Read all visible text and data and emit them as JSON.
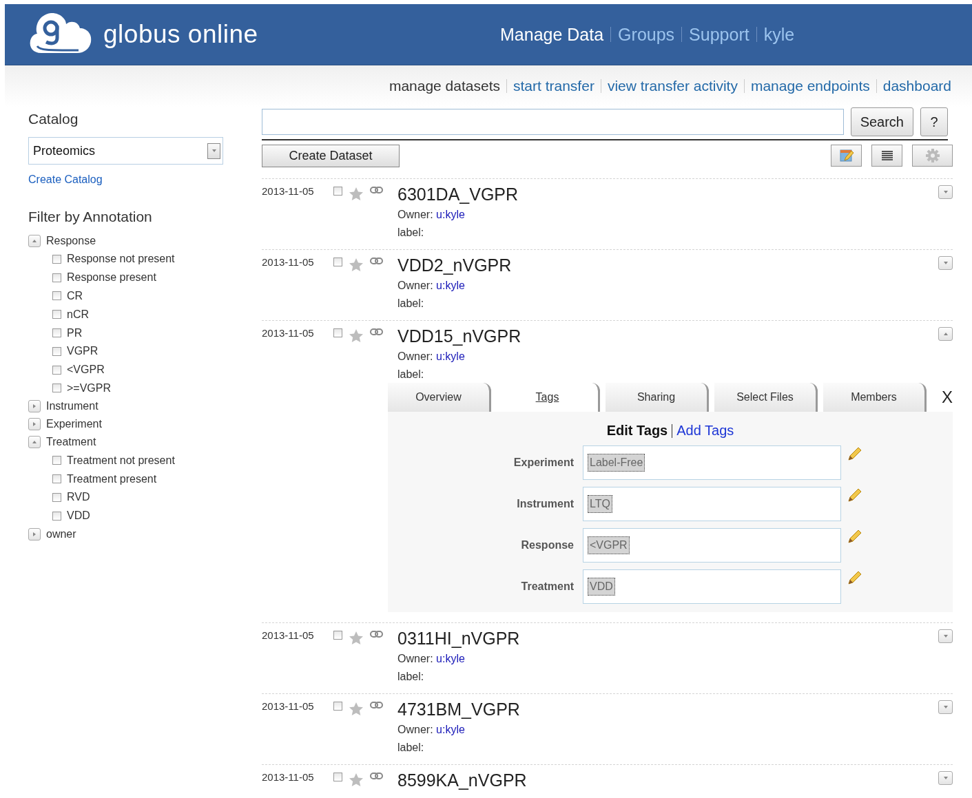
{
  "header": {
    "logo_text": "globus online",
    "nav": [
      {
        "label": "Manage Data",
        "selected": true
      },
      {
        "label": "Groups",
        "selected": false
      },
      {
        "label": "Support",
        "selected": false
      },
      {
        "label": "kyle",
        "selected": false
      }
    ]
  },
  "subnav": [
    {
      "label": "manage datasets",
      "selected": true
    },
    {
      "label": "start transfer",
      "selected": false
    },
    {
      "label": "view transfer activity",
      "selected": false
    },
    {
      "label": "manage endpoints",
      "selected": false
    },
    {
      "label": "dashboard",
      "selected": false
    }
  ],
  "sidebar": {
    "catalog_title": "Catalog",
    "catalog_select": "Proteomics",
    "create_catalog": "Create Catalog",
    "filter_title": "Filter by Annotation",
    "filters": [
      {
        "label": "Response",
        "expanded": true,
        "children": [
          {
            "label": "Response not present",
            "checked": false
          },
          {
            "label": "Response present",
            "checked": false
          },
          {
            "label": "CR",
            "checked": false
          },
          {
            "label": "nCR",
            "checked": false
          },
          {
            "label": "PR",
            "checked": false
          },
          {
            "label": "VGPR",
            "checked": false
          },
          {
            "label": "<VGPR",
            "checked": false
          },
          {
            "label": ">=VGPR",
            "checked": false
          }
        ]
      },
      {
        "label": "Instrument",
        "expanded": false
      },
      {
        "label": "Experiment",
        "expanded": false
      },
      {
        "label": "Treatment",
        "expanded": true,
        "children": [
          {
            "label": "Treatment not present",
            "checked": false
          },
          {
            "label": "Treatment present",
            "checked": false
          },
          {
            "label": "RVD",
            "checked": false
          },
          {
            "label": "VDD",
            "checked": false
          }
        ]
      },
      {
        "label": "owner",
        "expanded": false
      }
    ]
  },
  "toolbar": {
    "search_button": "Search",
    "help_button": "?",
    "create_dataset": "Create Dataset"
  },
  "datasets": [
    {
      "date": "2013-11-05",
      "checked": false,
      "title": "6301DA_VGPR",
      "owner_label": "Owner:",
      "owner": "u:kyle",
      "label": "label:",
      "expanded": false
    },
    {
      "date": "2013-11-05",
      "checked": false,
      "title": "VDD2_nVGPR",
      "owner_label": "Owner:",
      "owner": "u:kyle",
      "label": "label:",
      "expanded": false
    },
    {
      "date": "2013-11-05",
      "checked": false,
      "title": "VDD15_nVGPR",
      "owner_label": "Owner:",
      "owner": "u:kyle",
      "label": "label:",
      "expanded": true,
      "details": {
        "tabs": [
          {
            "label": "Overview",
            "selected": false
          },
          {
            "label": "Tags",
            "selected": true
          },
          {
            "label": "Sharing",
            "selected": false
          },
          {
            "label": "Select Files",
            "selected": false
          },
          {
            "label": "Members",
            "selected": false
          }
        ],
        "close": "X",
        "edit_tags": "Edit Tags",
        "add_tags": "Add Tags",
        "fields": [
          {
            "label": "Experiment",
            "value": "Label-Free"
          },
          {
            "label": "Instrument",
            "value": "LTQ"
          },
          {
            "label": "Response",
            "value": "<VGPR"
          },
          {
            "label": "Treatment",
            "value": "VDD"
          }
        ]
      }
    },
    {
      "date": "2013-11-05",
      "checked": false,
      "title": "0311HI_nVGPR",
      "owner_label": "Owner:",
      "owner": "u:kyle",
      "label": "label:",
      "expanded": false
    },
    {
      "date": "2013-11-05",
      "checked": false,
      "title": "4731BM_VGPR",
      "owner_label": "Owner:",
      "owner": "u:kyle",
      "label": "label:",
      "expanded": false
    },
    {
      "date": "2013-11-05",
      "checked": false,
      "title": "8599KA_nVGPR",
      "expanded": false
    }
  ]
}
